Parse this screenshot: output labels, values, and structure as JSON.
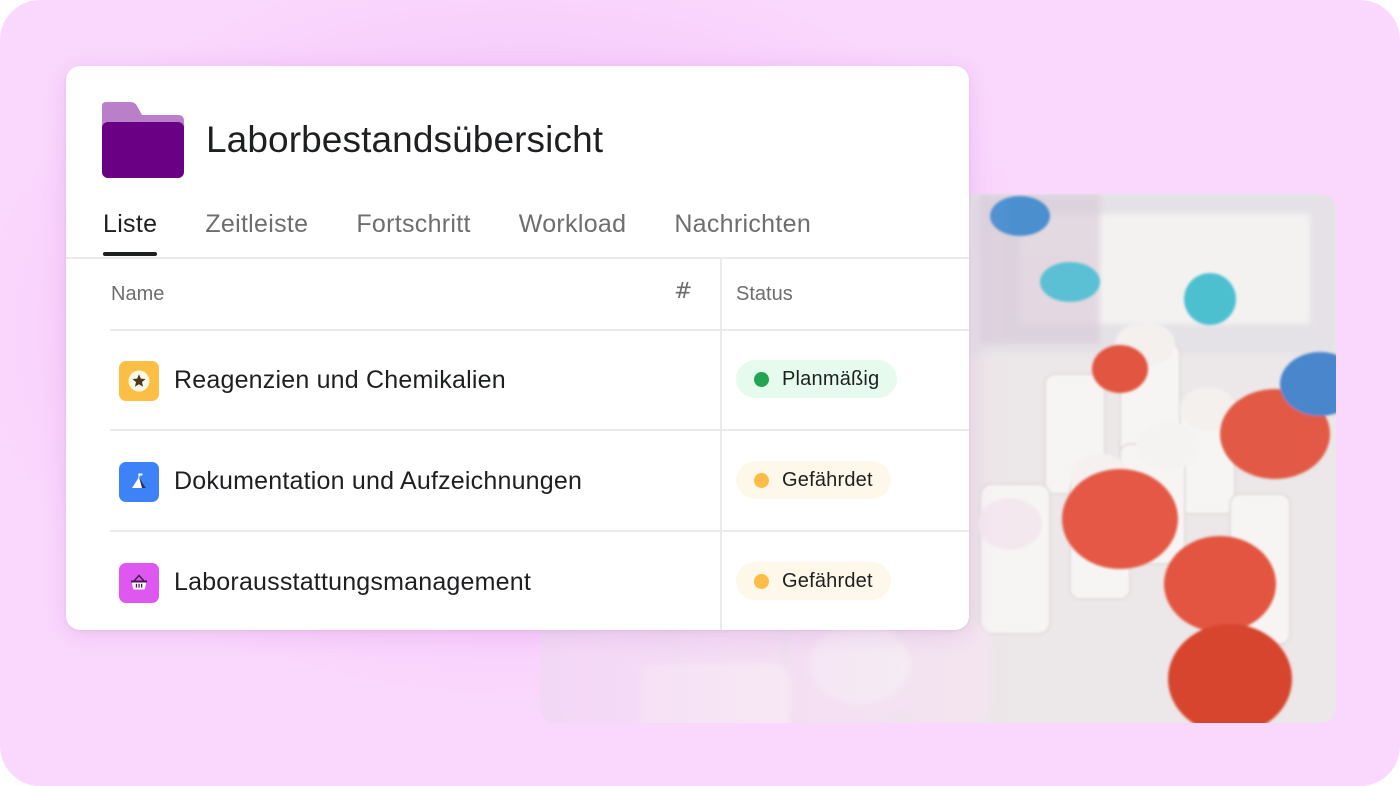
{
  "project": {
    "title": "Laborbestandsübersicht",
    "icon": "folder-icon",
    "colors": {
      "folder_tab": "#b97fc9",
      "folder_body": "#6a0084"
    }
  },
  "tabs": [
    {
      "label": "Liste",
      "active": true
    },
    {
      "label": "Zeitleiste",
      "active": false
    },
    {
      "label": "Fortschritt",
      "active": false
    },
    {
      "label": "Workload",
      "active": false
    },
    {
      "label": "Nachrichten",
      "active": false
    }
  ],
  "table": {
    "columns": {
      "name": "Name",
      "hash_icon": "#",
      "status": "Status"
    },
    "rows": [
      {
        "name": "Reagenzien und Chemikalien",
        "icon": "star-icon",
        "icon_color": "#fbbf45",
        "status": "Planmäßig",
        "status_color": "#22a552",
        "status_bg": "#e6fbee"
      },
      {
        "name": "Dokumentation und Aufzeichnungen",
        "icon": "mountain-flag-icon",
        "icon_color": "#3d82f6",
        "status": "Gefährdet",
        "status_color": "#fbbd45",
        "status_bg": "#fef8ea"
      },
      {
        "name": "Laborausstattungsmanagement",
        "icon": "basket-icon",
        "icon_color": "#de57f0",
        "status": "Gefährdet",
        "status_color": "#fbbd45",
        "status_bg": "#fef8ea"
      }
    ]
  },
  "background": {
    "photo": "lab-sample-bottles-photo",
    "accent": "#f5c5fa"
  }
}
